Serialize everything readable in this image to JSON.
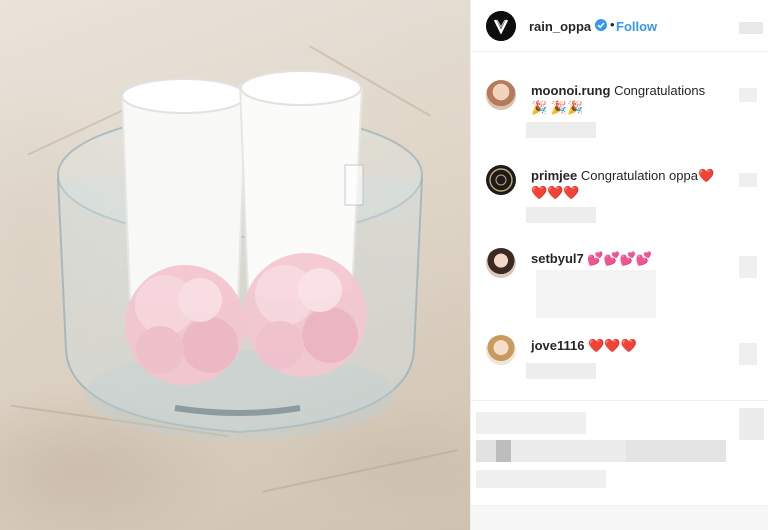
{
  "post": {
    "author": "rain_oppa",
    "follow_label": "Follow",
    "separator": "•"
  },
  "comments": [
    {
      "user": "moonoi.rung",
      "text": "Congratulations 🎉 🎉🎉"
    },
    {
      "user": "primjee",
      "text": "Congratulation oppa❤️ ❤️❤️❤️"
    },
    {
      "user": "setbyul7",
      "text": "💕💕💕💕"
    },
    {
      "user": "jove1116",
      "text": "❤️❤️❤️"
    }
  ],
  "colors": {
    "link": "#3897f0",
    "text": "#262626",
    "verified": "#3897f0"
  }
}
